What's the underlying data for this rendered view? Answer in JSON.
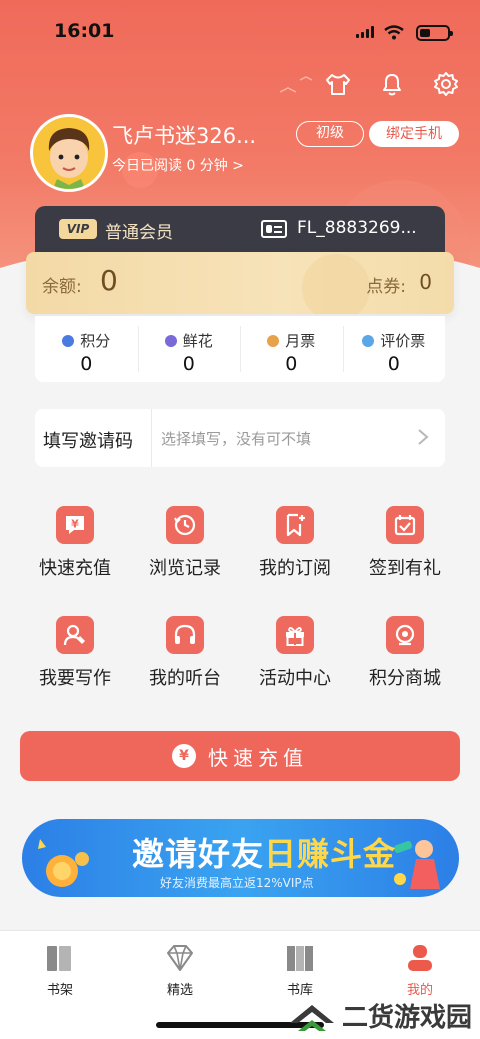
{
  "status_bar": {
    "time": "16:01"
  },
  "profile": {
    "username": "飞卢书迷326...",
    "read_today": "今日已阅读 0 分钟 >",
    "level": "初级",
    "bind_phone": "绑定手机"
  },
  "member": {
    "vip_tag": "VIP",
    "type": "普通会员",
    "id": "FL_8883269..."
  },
  "balance": {
    "label": "余额:",
    "value": "0",
    "coupon_label": "点券:",
    "coupon_value": "0"
  },
  "stats": [
    {
      "label": "积分",
      "value": "0",
      "color": "#4a7be0"
    },
    {
      "label": "鲜花",
      "value": "0",
      "color": "#7a6ad8"
    },
    {
      "label": "月票",
      "value": "0",
      "color": "#e8a24a"
    },
    {
      "label": "评价票",
      "value": "0",
      "color": "#5aa6e6"
    }
  ],
  "invite": {
    "label": "填写邀请码",
    "placeholder": "选择填写，没有可不填"
  },
  "grid": [
    [
      {
        "label": "快速充值",
        "icon": "yen-bubble-icon"
      },
      {
        "label": "浏览记录",
        "icon": "history-icon"
      },
      {
        "label": "我的订阅",
        "icon": "bookmark-add-icon"
      },
      {
        "label": "签到有礼",
        "icon": "calendar-check-icon"
      }
    ],
    [
      {
        "label": "我要写作",
        "icon": "writer-icon"
      },
      {
        "label": "我的听台",
        "icon": "headphones-icon"
      },
      {
        "label": "活动中心",
        "icon": "gift-icon"
      },
      {
        "label": "积分商城",
        "icon": "points-store-icon"
      }
    ]
  ],
  "charge_button": {
    "label": "快速充值",
    "icon_glyph": "¥"
  },
  "banner": {
    "title_a": "邀请好友",
    "title_b": "日赚斗金",
    "subtitle": "好友消费最高立返12%VIP点"
  },
  "tabbar": [
    {
      "label": "书架",
      "icon": "bookshelf-icon",
      "active": false
    },
    {
      "label": "精选",
      "icon": "diamond-icon",
      "active": false
    },
    {
      "label": "书库",
      "icon": "library-icon",
      "active": false
    },
    {
      "label": "我的",
      "icon": "profile-icon",
      "active": true
    }
  ],
  "watermark": {
    "text": "二货游戏园"
  },
  "colors": {
    "accent": "#ef665b",
    "member_card": "#3b3b45",
    "gold": "#f3d9a6",
    "banner_blue": "#2c7fe6"
  }
}
